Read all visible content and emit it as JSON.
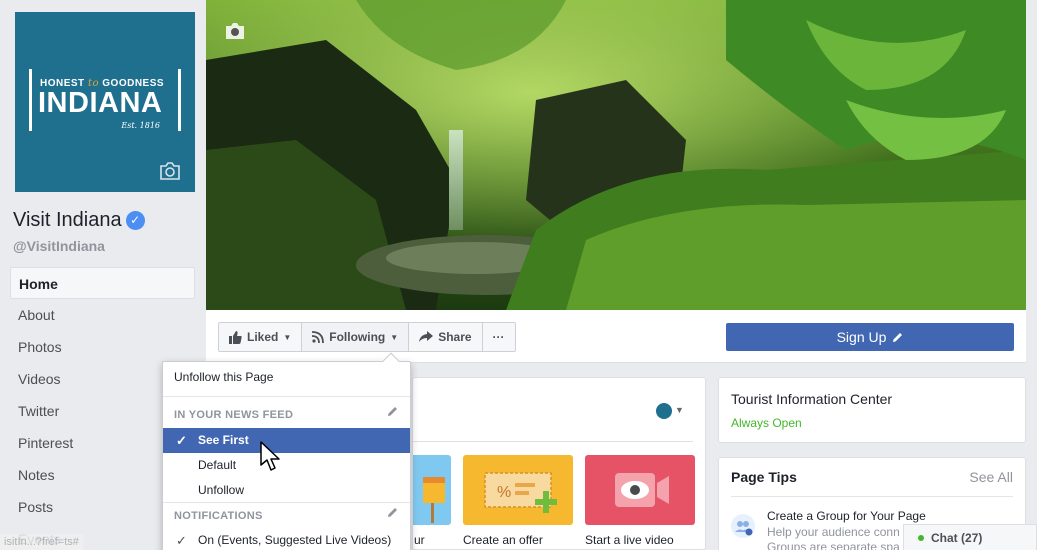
{
  "page": {
    "name": "Visit Indiana",
    "handle": "@VisitIndiana",
    "logo": {
      "top_line_1": "HONEST",
      "top_script": "to",
      "top_line_2": "GOODNESS",
      "main": "INDIANA",
      "est": "Est. 1816"
    }
  },
  "nav": {
    "items": [
      "Home",
      "About",
      "Photos",
      "Videos",
      "Twitter",
      "Pinterest",
      "Notes",
      "Posts",
      "Events"
    ],
    "active_index": 0
  },
  "actions": {
    "liked": "Liked",
    "following": "Following",
    "share": "Share",
    "more": "···",
    "signup": "Sign Up"
  },
  "dropdown": {
    "unfollow_page": "Unfollow this Page",
    "news_feed_header": "IN YOUR NEWS FEED",
    "news_feed_options": [
      "See First",
      "Default",
      "Unfollow"
    ],
    "selected_option": "See First",
    "notifications_header": "NOTIFICATIONS",
    "notifications_value": "On (Events, Suggested Live Videos)"
  },
  "main_card": {
    "tiles": [
      {
        "label": "ur",
        "color": "#7fc9f0"
      },
      {
        "label": "Create an offer",
        "color": "#f5b82e"
      },
      {
        "label": "Start a live video",
        "color": "#e65266"
      }
    ]
  },
  "info_card": {
    "title": "Tourist Information Center",
    "status": "Always Open"
  },
  "page_tips": {
    "title": "Page Tips",
    "see_all": "See All",
    "tip_title": "Create a Group for Your Page",
    "tip_desc_1": "Help your audience conn",
    "tip_desc_2": "Groups are separate spa"
  },
  "chat": {
    "label": "Chat (27)"
  },
  "status_url": "isitIn...?fref=ts#",
  "colors": {
    "brand": "#4267b2",
    "profile_bg": "#1f6f8f",
    "open_green": "#42b72a"
  }
}
